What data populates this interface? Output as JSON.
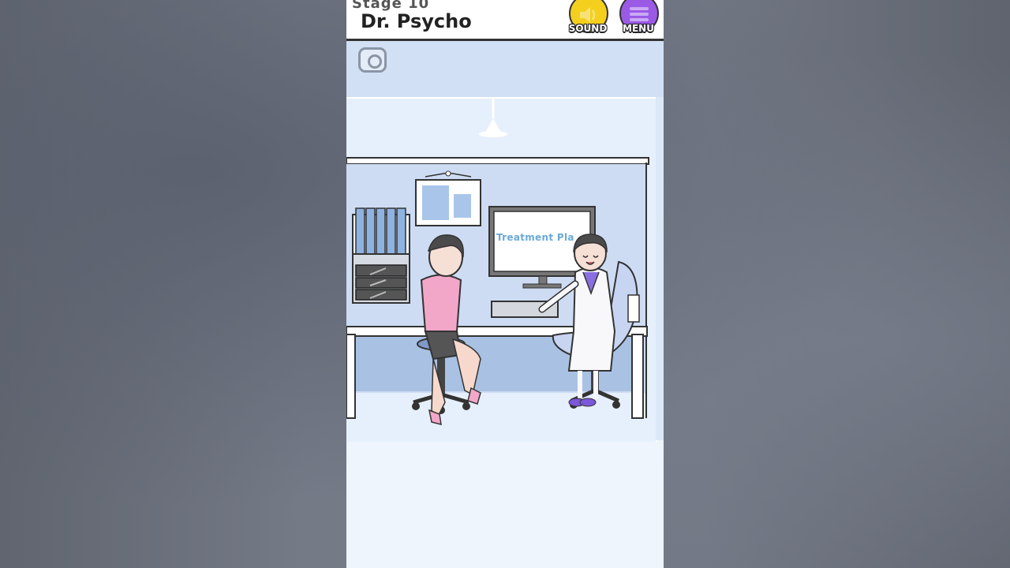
{
  "header": {
    "stage_label": "Stage 10",
    "title": "Dr. Psycho",
    "sound_label": "SOUND",
    "menu_label": "MENU"
  },
  "scene": {
    "monitor_text": "Treatment Pla",
    "icons": [
      "camera-icon",
      "speaker-icon",
      "hamburger-menu-icon"
    ]
  },
  "colors": {
    "sound_button": "#f5cf1d",
    "menu_button": "#9b5ae6",
    "wall": "#cfdff6",
    "floor": "#eef5fd"
  }
}
